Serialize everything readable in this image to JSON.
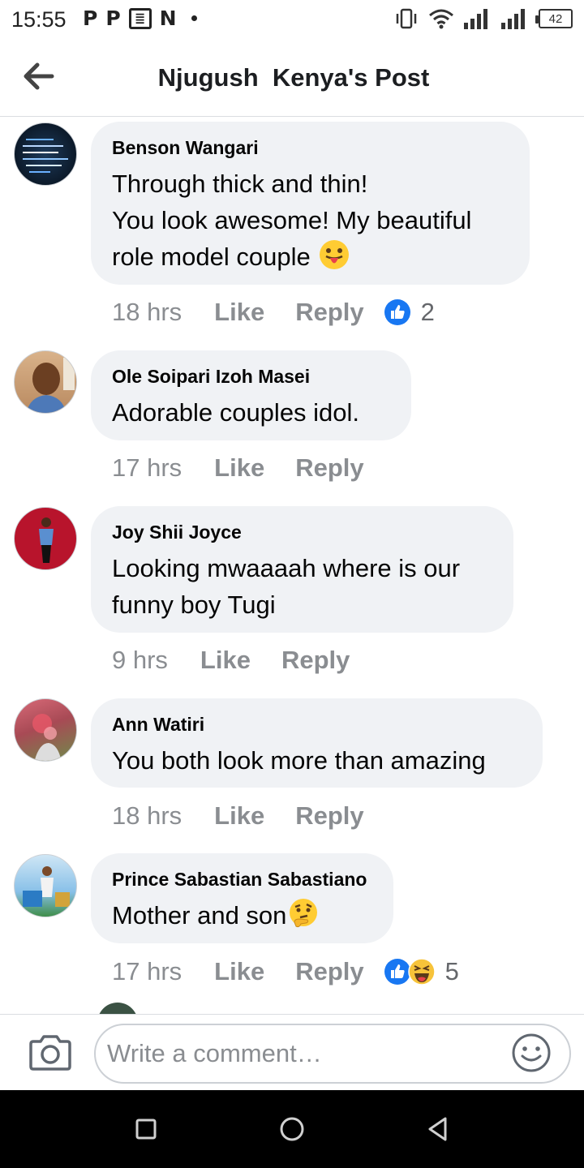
{
  "status_bar": {
    "time": "15:55",
    "apps": [
      "P",
      "P",
      "≣",
      "N"
    ],
    "battery": "42"
  },
  "header": {
    "title": "Njugush  Kenya's Post"
  },
  "comments": [
    {
      "author": "Benson Wangari",
      "text": "Through thick and thin!\nYou look awesome! My beautiful role model couple",
      "emoji": "tongue-out-emoji",
      "time": "18 hrs",
      "like_label": "Like",
      "reply_label": "Reply",
      "reactions": [
        "like"
      ],
      "reaction_count": "2"
    },
    {
      "author": "Ole Soipari Izoh Masei",
      "text": "Adorable  couples idol.",
      "time": "17 hrs",
      "like_label": "Like",
      "reply_label": "Reply"
    },
    {
      "author": "Joy Shii Joyce",
      "text": "Looking mwaaaah where is our funny boy Tugi",
      "time": "9 hrs",
      "like_label": "Like",
      "reply_label": "Reply"
    },
    {
      "author": "Ann Watiri",
      "text": "You both look more than amazing",
      "time": "18 hrs",
      "like_label": "Like",
      "reply_label": "Reply"
    },
    {
      "author": "Prince Sabastian Sabastiano",
      "text": "Mother and son",
      "emoji": "thinking-face-emoji",
      "time": "17 hrs",
      "like_label": "Like",
      "reply_label": "Reply",
      "reactions": [
        "like",
        "haha"
      ],
      "reaction_count": "5"
    }
  ],
  "composer": {
    "placeholder": "Write a comment…"
  },
  "colors": {
    "bubble": "#f0f2f5",
    "meta": "#8a8d91",
    "like_blue": "#1877f2"
  }
}
